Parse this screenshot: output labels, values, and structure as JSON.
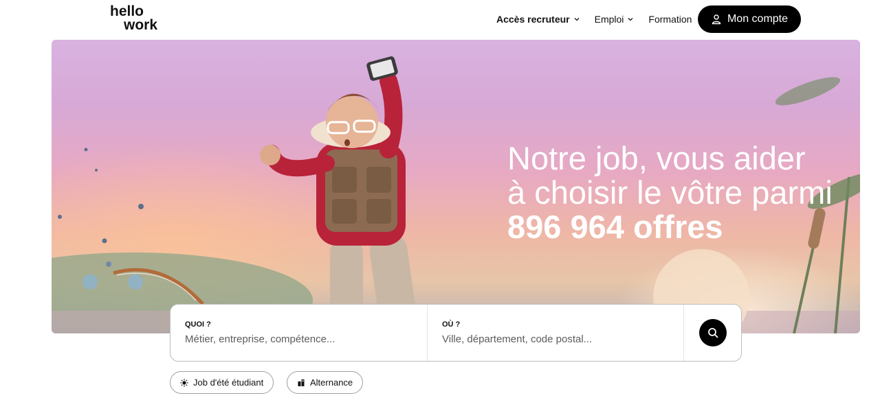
{
  "header": {
    "logo": {
      "line1": "hello",
      "line2": "work"
    },
    "nav": [
      {
        "label": "Accès recruteur",
        "icon": "chevron-down-icon"
      },
      {
        "label": "Emploi",
        "icon": "chevron-down-icon"
      },
      {
        "label": "Formation"
      }
    ],
    "account_button": {
      "label": "Mon compte",
      "icon": "user-icon"
    }
  },
  "hero": {
    "line1": "Notre job, vous aider",
    "line2": "à choisir le vôtre parmi",
    "line3": "896 964 offres"
  },
  "search": {
    "what": {
      "label": "QUOI ?",
      "placeholder": "Métier, entreprise, compétence..."
    },
    "where": {
      "label": "OÙ ?",
      "placeholder": "Ville, département, code postal..."
    },
    "button_icon": "search-icon"
  },
  "chips": [
    {
      "label": "Job d'été étudiant",
      "icon": "sun-icon"
    },
    {
      "label": "Alternance",
      "icon": "building-icon"
    }
  ],
  "colors": {
    "primary": "#000000",
    "hero_text": "#ffffff",
    "border": "#bdbdbd"
  }
}
